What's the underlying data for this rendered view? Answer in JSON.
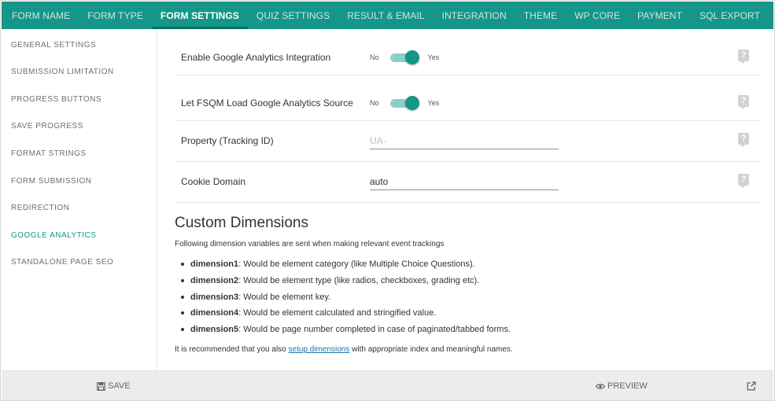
{
  "tabs": [
    {
      "label": "FORM NAME",
      "active": false
    },
    {
      "label": "FORM TYPE",
      "active": false
    },
    {
      "label": "FORM SETTINGS",
      "active": true
    },
    {
      "label": "QUIZ SETTINGS",
      "active": false
    },
    {
      "label": "RESULT & EMAIL",
      "active": false
    },
    {
      "label": "INTEGRATION",
      "active": false
    },
    {
      "label": "THEME",
      "active": false
    },
    {
      "label": "WP CORE",
      "active": false
    },
    {
      "label": "PAYMENT",
      "active": false
    },
    {
      "label": "SQL EXPORT",
      "active": false
    }
  ],
  "sidebar": {
    "items": [
      {
        "label": "GENERAL SETTINGS"
      },
      {
        "label": "SUBMISSION LIMITATION"
      },
      {
        "label": "PROGRESS BUTTONS"
      },
      {
        "label": "SAVE PROGRESS"
      },
      {
        "label": "FORMAT STRINGS"
      },
      {
        "label": "FORM SUBMISSION"
      },
      {
        "label": "REDIRECTION"
      },
      {
        "label": "GOOGLE ANALYTICS",
        "active": true
      },
      {
        "label": "STANDALONE PAGE SEO"
      }
    ]
  },
  "settings": {
    "enable_ga": {
      "label": "Enable Google Analytics Integration",
      "off_label": "No",
      "on_label": "Yes",
      "checked": true
    },
    "load_source": {
      "label": "Let FSQM Load Google Analytics Source",
      "off_label": "No",
      "on_label": "Yes",
      "checked": true
    },
    "tracking_id": {
      "label": "Property (Tracking ID)",
      "value": "",
      "placeholder": "UA-"
    },
    "cookie_domain": {
      "label": "Cookie Domain",
      "value": "auto"
    },
    "help_symbol": "?"
  },
  "custom_dimensions": {
    "heading": "Custom Dimensions",
    "description": "Following dimension variables are sent when making relevant event trackings",
    "items": [
      {
        "key": "dimension1",
        "text": ": Would be element category (like Multiple Choice Questions)."
      },
      {
        "key": "dimension2",
        "text": ": Would be element type (like radios, checkboxes, grading etc)."
      },
      {
        "key": "dimension3",
        "text": ": Would be element key."
      },
      {
        "key": "dimension4",
        "text": ": Would be element calculated and stringified value."
      },
      {
        "key": "dimension5",
        "text": ": Would be page number completed in case of paginated/tabbed forms."
      }
    ],
    "note_before": "It is recommended that you also ",
    "note_link": "setup dimensions",
    "note_after": " with appropriate index and meaningful names."
  },
  "bottombar": {
    "save_label": "SAVE",
    "preview_label": "PREVIEW"
  },
  "icons": {
    "save": "floppy-disk-icon",
    "preview": "eye-icon",
    "external": "external-link-icon",
    "help": "help-icon"
  },
  "colors": {
    "accent": "#159688",
    "accent_dark": "#0b6f64",
    "toggle_track": "#8ccfc6",
    "link": "#1a73a8",
    "bottombar_bg": "#ececec"
  }
}
